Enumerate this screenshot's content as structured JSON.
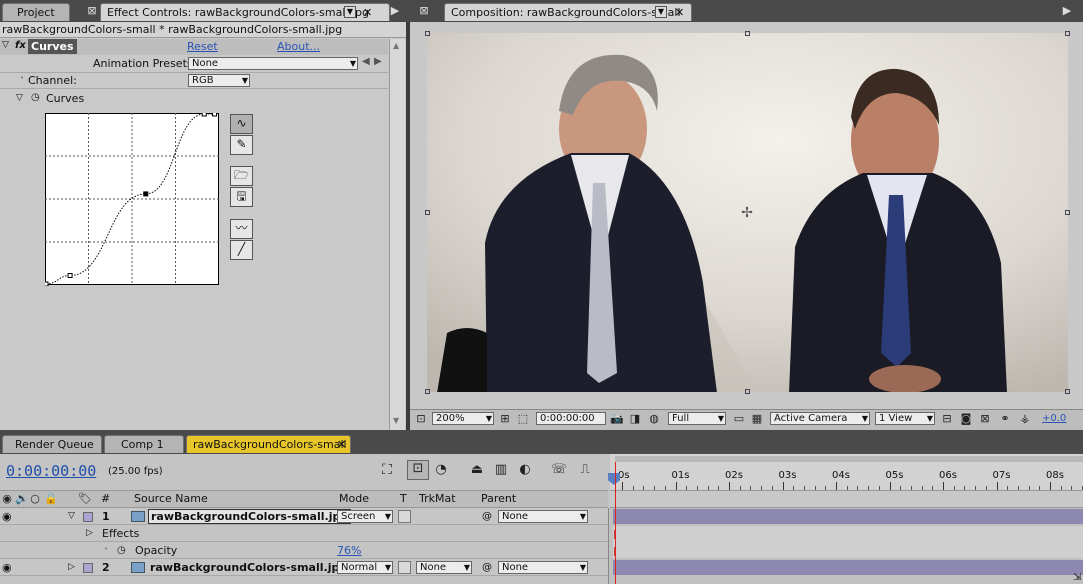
{
  "top_tabs": {
    "project": "Project",
    "effect_controls": "Effect Controls: rawBackgroundColors-small.jpg",
    "composition": "Composition: rawBackgroundColors-small"
  },
  "effect_controls": {
    "breadcrumb": "rawBackgroundColors-small * rawBackgroundColors-small.jpg",
    "effect_name": "Curves",
    "fx_badge": "fx",
    "reset": "Reset",
    "about": "About...",
    "animation_presets_label": "Animation Presets:",
    "animation_presets_value": "None",
    "channel_label": "Channel:",
    "channel_value": "RGB",
    "curves_label": "Curves"
  },
  "curves": {
    "points": [
      [
        0,
        0
      ],
      [
        0.14,
        0.05
      ],
      [
        0.58,
        0.53
      ],
      [
        0.92,
        1.0
      ],
      [
        0.98,
        1.0
      ]
    ],
    "tools": [
      "bezier-icon",
      "pencil-icon",
      "open-icon",
      "save-icon",
      "smooth-icon",
      "reset-line-icon"
    ]
  },
  "composition_toolbar": {
    "zoom": "200%",
    "timecode": "0:00:00:00",
    "resolution": "Full",
    "camera": "Active Camera",
    "view": "1 View",
    "exposure": "+0.0"
  },
  "timeline_tabs": [
    "Render Queue",
    "Comp 1",
    "rawBackgroundColors-small"
  ],
  "timeline": {
    "current_time": "0:00:00:00",
    "fps": "(25.00 fps)",
    "ruler": [
      "0s",
      "01s",
      "02s",
      "03s",
      "04s",
      "05s",
      "06s",
      "07s",
      "08s"
    ],
    "columns": {
      "num": "#",
      "source": "Source Name",
      "mode": "Mode",
      "t": "T",
      "trkmat": "TrkMat",
      "parent": "Parent"
    },
    "layers": [
      {
        "num": "1",
        "name": "rawBackgroundColors-small.jpg",
        "mode": "Screen",
        "trkmat": "",
        "parent": "None"
      },
      {
        "num": "2",
        "name": "rawBackgroundColors-small.jpg",
        "mode": "Normal",
        "trkmat": "None",
        "parent": "None"
      }
    ],
    "effects_label": "Effects",
    "opacity_label": "Opacity",
    "opacity_value": "76%"
  },
  "colors": {
    "accent": "#2a53b5",
    "playhead": "#e02020",
    "layer_bar": "#8c88b0",
    "time_blue": "#1f4fa8"
  }
}
